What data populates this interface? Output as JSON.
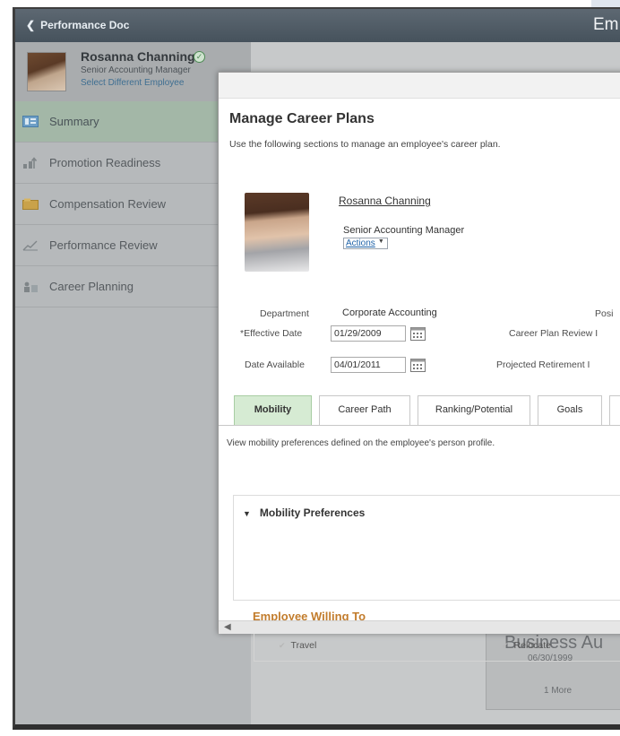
{
  "topbar": {
    "back_label": "Performance Doc",
    "title": "Em"
  },
  "employee": {
    "name": "Rosanna Channing",
    "title": "Senior Accounting Manager",
    "select_link": "Select Different Employee"
  },
  "sidebar": {
    "items": [
      {
        "label": "Summary",
        "icon": "summary-icon",
        "active": true
      },
      {
        "label": "Promotion Readiness",
        "icon": "promotion-icon",
        "active": false
      },
      {
        "label": "Compensation Review",
        "icon": "compensation-icon",
        "active": false
      },
      {
        "label": "Performance Review",
        "icon": "performance-icon",
        "active": false
      },
      {
        "label": "Career Planning",
        "icon": "career-icon",
        "active": false
      }
    ]
  },
  "background_card": {
    "title": "Business Au",
    "date": "06/30/1999",
    "more": "1 More"
  },
  "dialog": {
    "title": "Manage Career Plans",
    "description": "Use the following sections to manage an employee's career plan.",
    "profile": {
      "name": "Rosanna Channing",
      "job_title": "Senior Accounting Manager",
      "actions_label": "Actions"
    },
    "fields": {
      "department_label": "Department",
      "department_value": "Corporate Accounting",
      "position_label": "Posi",
      "effective_date_label": "*Effective Date",
      "effective_date_value": "01/29/2009",
      "review_label": "Career Plan Review I",
      "date_available_label": "Date Available",
      "date_available_value": "04/01/2011",
      "retirement_label": "Projected Retirement I"
    },
    "tabs": [
      {
        "label": "Mobility",
        "active": true
      },
      {
        "label": "Career Path",
        "active": false
      },
      {
        "label": "Ranking/Potential",
        "active": false
      },
      {
        "label": "Goals",
        "active": false
      }
    ],
    "mobility_description": "View mobility preferences defined on the employee's person profile.",
    "mobility_group_title": "Mobility Preferences",
    "willing_label": "Employee Willing To",
    "checkboxes": [
      {
        "label": "Travel",
        "checked": true
      },
      {
        "label": "Relocate",
        "checked": true
      }
    ]
  },
  "colors": {
    "header": "#4f5b65",
    "active_tab": "#d6ebd3",
    "willing_label": "#c27c2c",
    "link": "#1f63a8"
  }
}
